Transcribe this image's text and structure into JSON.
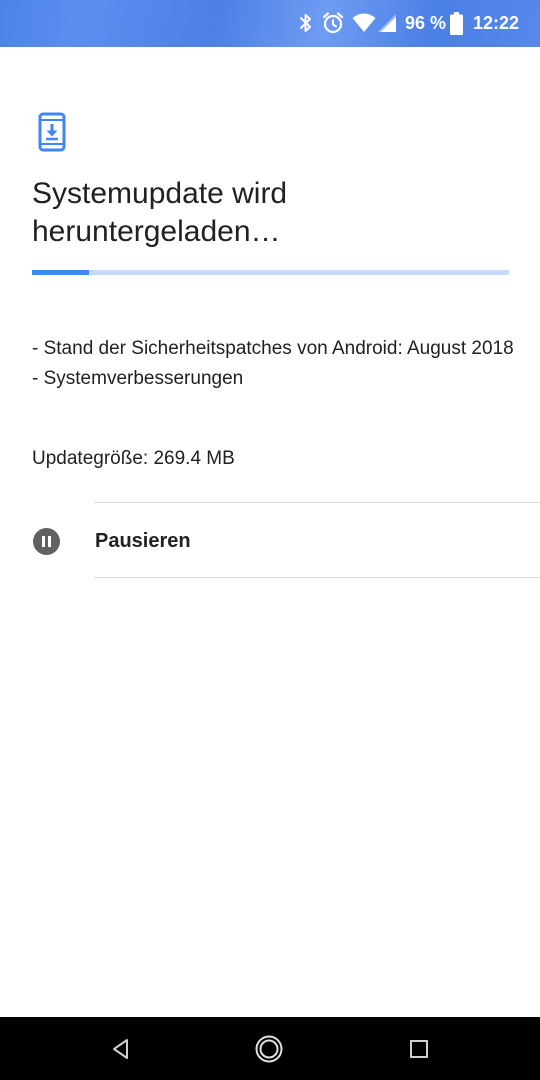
{
  "status_bar": {
    "battery_percent": "96 %",
    "time": "12:22",
    "icons": [
      "bluetooth-icon",
      "alarm-icon",
      "wifi-icon",
      "cellular-signal-icon",
      "battery-icon"
    ]
  },
  "update": {
    "icon": "system-update-download-icon",
    "title": "Systemupdate wird heruntergeladen…",
    "progress_fraction": 0.12,
    "notes": [
      "- Stand der Sicherheitspatches von Android: August 2018",
      "- Systemverbesserungen"
    ],
    "size_label": "Updategröße:",
    "size_value": "269.4 MB"
  },
  "actions": {
    "pause_label": "Pausieren",
    "pause_icon": "pause-circle-icon"
  },
  "nav_bar": {
    "icons": [
      "back-icon",
      "home-icon",
      "recents-icon"
    ]
  },
  "colors": {
    "accent": "#4285f4",
    "progress_track": "#c6dafc",
    "status_bar": "#4d82e8",
    "text": "#212121",
    "divider": "#dadada",
    "pause_icon": "#616161"
  }
}
